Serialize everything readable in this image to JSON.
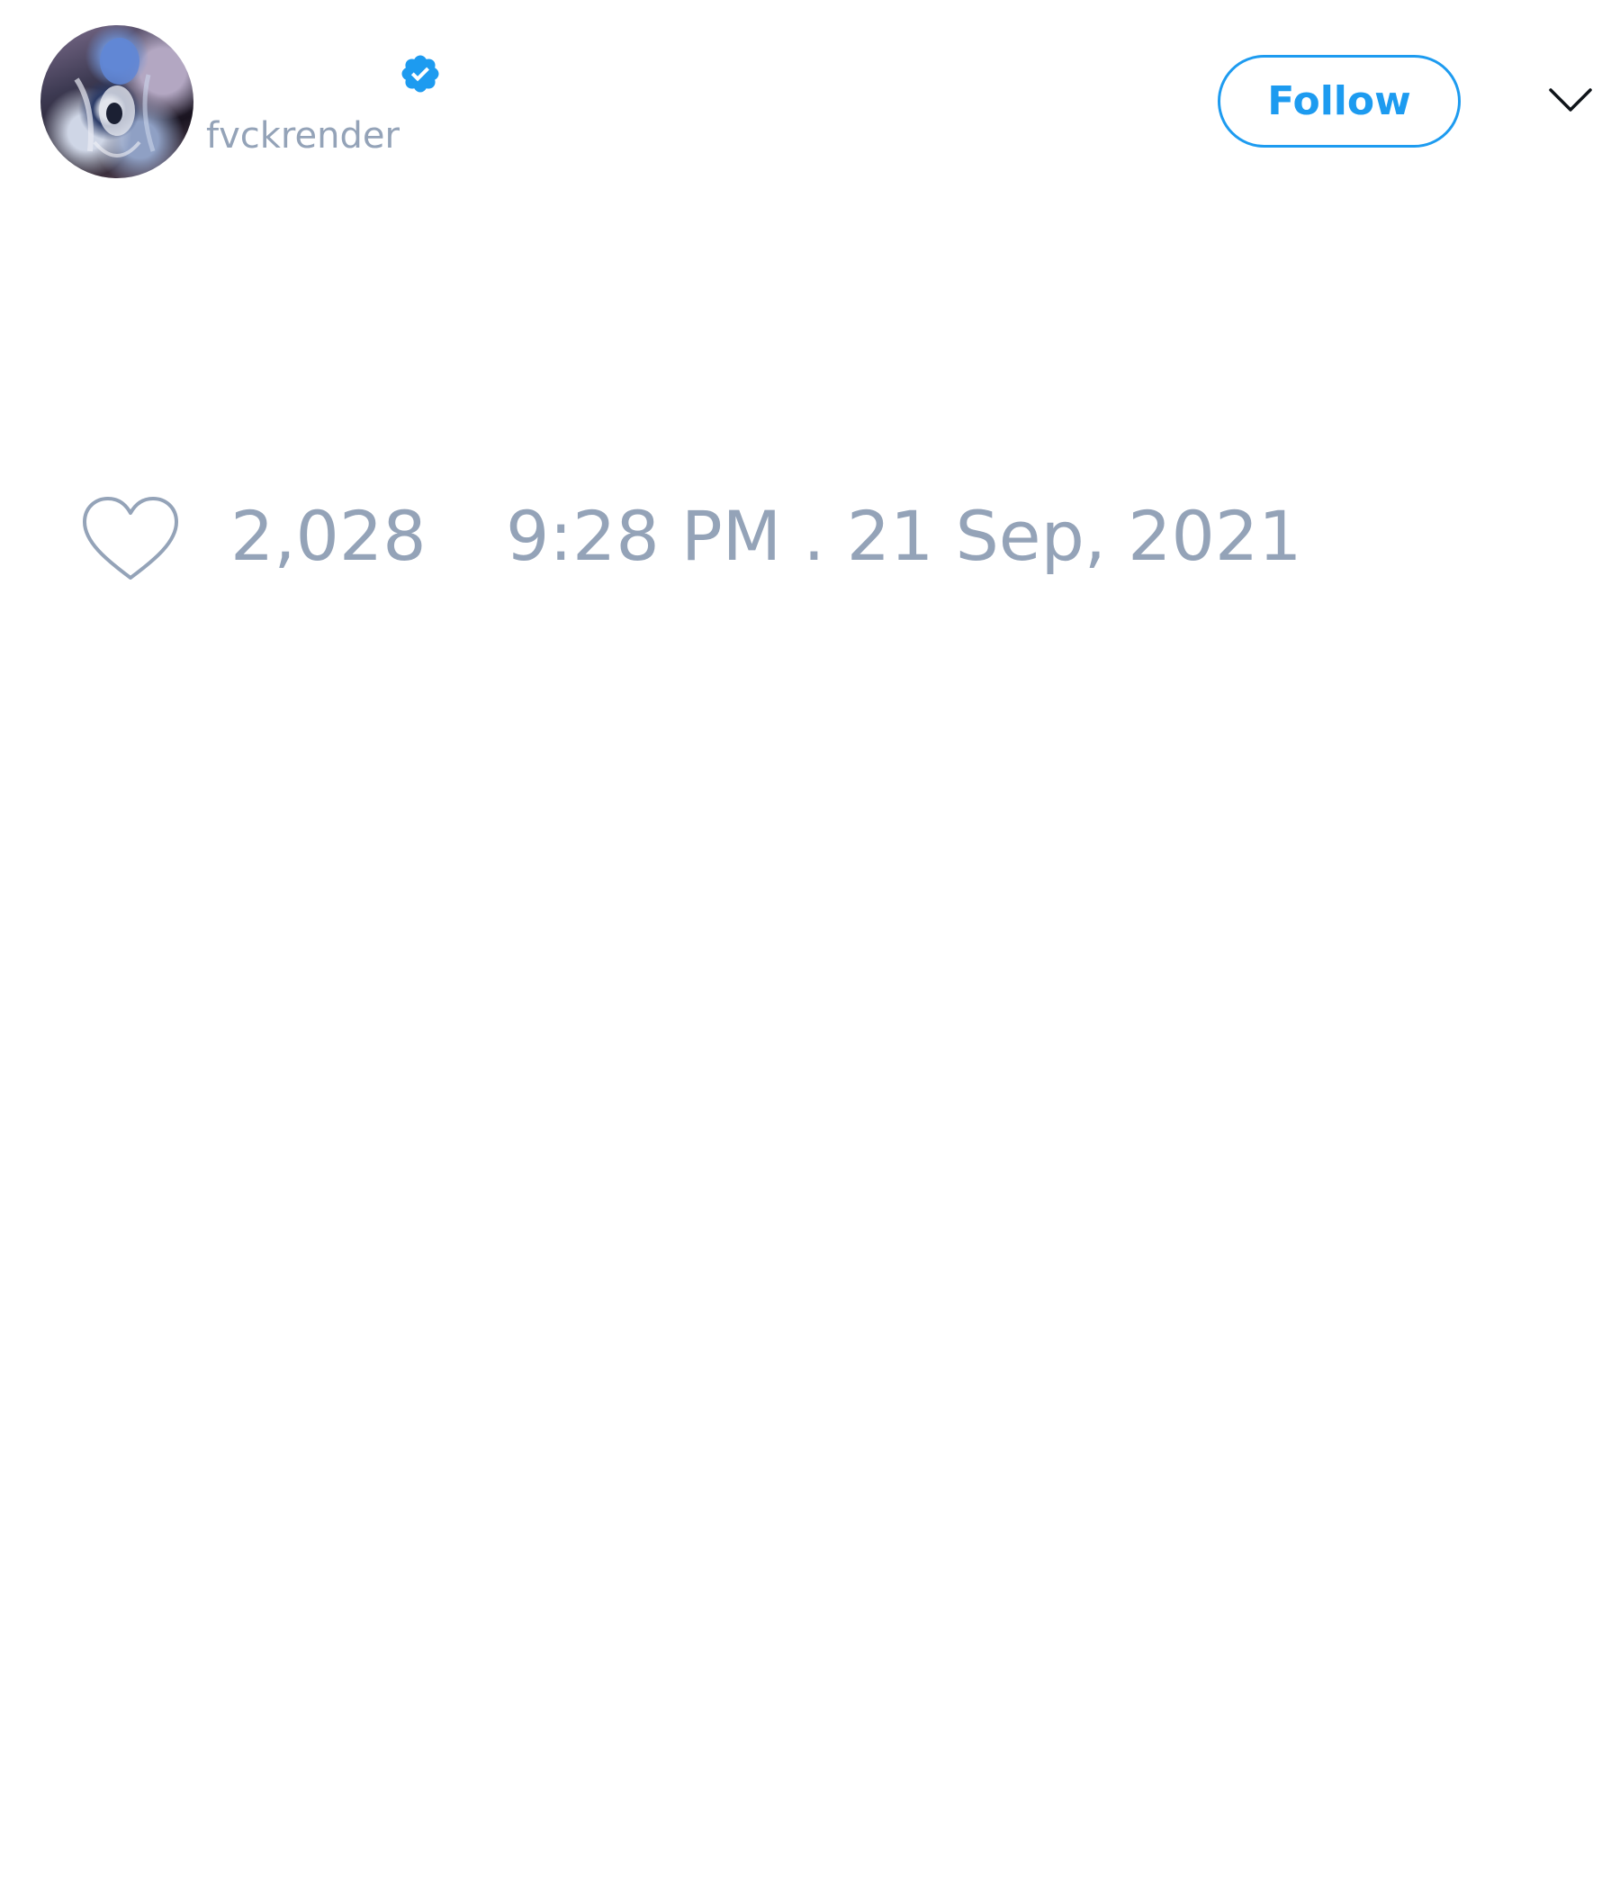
{
  "author": {
    "display_name": "",
    "handle": "fvckrender",
    "verified": true,
    "avatar_icon": "avatar-portrait"
  },
  "actions": {
    "follow_label": "Follow",
    "more_icon": "chevron-down-icon"
  },
  "engagement": {
    "like_icon": "heart-icon",
    "like_count": "2,028",
    "timestamp": "9:28 PM . 21 Sep, 2021"
  },
  "colors": {
    "accent": "#1d9bf0",
    "muted_text": "#94a3b8",
    "background": "#ffffff"
  }
}
